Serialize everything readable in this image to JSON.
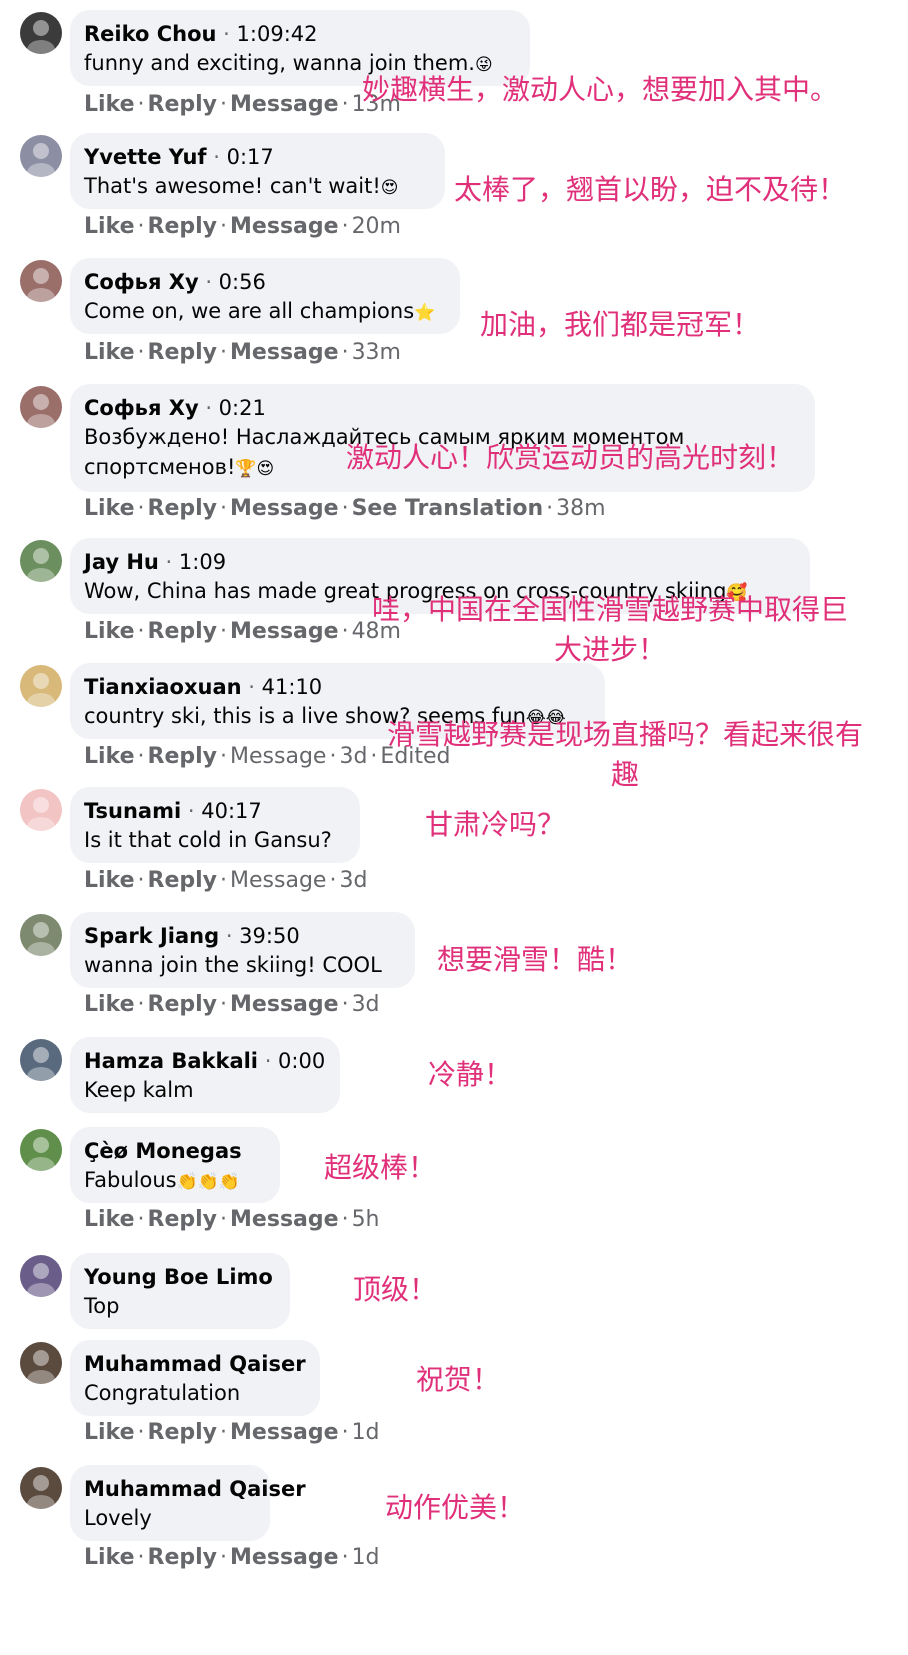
{
  "comments": [
    {
      "author": "Reiko Chou",
      "time": "1:09:42",
      "text": "funny and exciting, wanna join them.",
      "emoji": "😜",
      "actions": {
        "like": "Like",
        "reply": "Reply",
        "message": "Message",
        "age": "13m"
      },
      "translation": "妙趣横生，激动人心，想要加入其中。",
      "avatar_color": "#3b3b3b"
    },
    {
      "author": "Yvette Yuf",
      "time": "0:17",
      "text": "That's awesome!  can't wait!",
      "emoji": "😍",
      "actions": {
        "like": "Like",
        "reply": "Reply",
        "message": "Message",
        "age": "20m"
      },
      "translation": "太棒了，翘首以盼，迫不及待！",
      "avatar_color": "#8c8fa3"
    },
    {
      "author": "Софья Ху",
      "time": "0:56",
      "text": "Come on, we are all champions",
      "emoji": "⭐",
      "actions": {
        "like": "Like",
        "reply": "Reply",
        "message": "Message",
        "age": "33m"
      },
      "translation": "加油，我们都是冠军！",
      "avatar_color": "#9a6f6a"
    },
    {
      "author": "Софья Ху",
      "time": "0:21",
      "text": "Возбуждено! Наслаждайтесь самым ярким моментом",
      "text2": "спортсменов!",
      "emoji": "🏆😍",
      "actions": {
        "like": "Like",
        "reply": "Reply",
        "message": "Message",
        "extra": "See Translation",
        "age": "38m"
      },
      "translation": "激动人心！欣赏运动员的高光时刻！",
      "avatar_color": "#9a6f6a"
    },
    {
      "author": "Jay Hu",
      "time": "1:09",
      "text": "Wow, China has made great progress on cross-country skiing",
      "emoji": "🥰",
      "actions": {
        "like": "Like",
        "reply": "Reply",
        "message": "Message",
        "age": "48m"
      },
      "translation": "哇，中国在全国性滑雪越野赛中取得巨大进步！",
      "avatar_color": "#6b8f5e"
    },
    {
      "author": "Tianxiaoxuan",
      "time": "41:10",
      "text": "country ski, this is a live show? seems fun",
      "emoji": "😂😂",
      "actions": {
        "like": "Like",
        "reply": "Reply",
        "message": "Message",
        "age": "3d",
        "edited": "Edited"
      },
      "translation": "滑雪越野赛是现场直播吗？看起来很有趣",
      "avatar_color": "#d8b97a"
    },
    {
      "author": "Tsunami",
      "time": "40:17",
      "text": "Is it that cold in Gansu?",
      "emoji": "",
      "actions": {
        "like": "Like",
        "reply": "Reply",
        "message": "Message",
        "age": "3d"
      },
      "translation": "甘肃冷吗？",
      "avatar_color": "#f2c4c4"
    },
    {
      "author": "Spark Jiang",
      "time": "39:50",
      "text": "wanna join the skiing! COOL",
      "emoji": "",
      "actions": {
        "like": "Like",
        "reply": "Reply",
        "message": "Message",
        "age": "3d"
      },
      "translation": "想要滑雪！酷！",
      "avatar_color": "#7d8a6f"
    },
    {
      "author": "Hamza Bakkali",
      "time": "0:00",
      "text": "Keep kalm",
      "emoji": "",
      "translation": "冷静！",
      "avatar_color": "#5a6a7e"
    },
    {
      "author": "Çèø Monegas",
      "time": "",
      "text": "Fabulous",
      "emoji": "👏👏👏",
      "actions": {
        "like": "Like",
        "reply": "Reply",
        "message": "Message",
        "age": "5h"
      },
      "translation": "超级棒！",
      "avatar_color": "#5f8f4a"
    },
    {
      "author": "Young Boe Limo",
      "time": "",
      "text": "Top",
      "emoji": "",
      "translation": "顶级！",
      "avatar_color": "#6a5d8a"
    },
    {
      "author": "Muhammad Qaiser",
      "time": "",
      "text": "Congratulation",
      "emoji": "",
      "actions": {
        "like": "Like",
        "reply": "Reply",
        "message": "Message",
        "age": "1d"
      },
      "translation": "祝贺！",
      "avatar_color": "#5b4a3e"
    },
    {
      "author": "Muhammad Qaiser",
      "time": "",
      "text": "Lovely",
      "emoji": "",
      "actions": {
        "like": "Like",
        "reply": "Reply",
        "message": "Message",
        "age": "1d"
      },
      "translation": "动作优美！",
      "avatar_color": "#5b4a3e"
    }
  ]
}
